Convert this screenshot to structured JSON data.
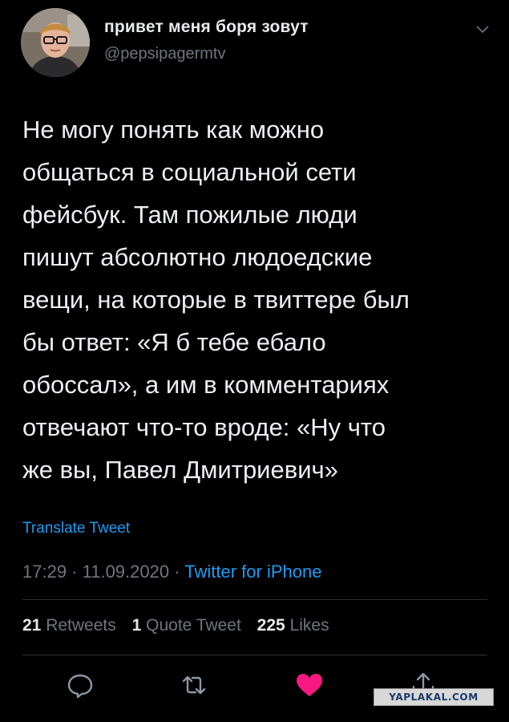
{
  "user": {
    "display_name": "привет меня боря зовут",
    "handle": "@pepsipagermtv"
  },
  "tweet": {
    "text": "Не могу понять как можно\nобщаться в социальной сети\nфейсбук. Там пожилые люди\nпишут абсолютно людоедские\nвещи, на которые в твиттере был\nбы ответ: «Я б тебе ебало\nобоссал», а им в комментариях\nотвечают что-то вроде: «Ну что\nже вы, Павел Дмитриевич»",
    "translate_label": "Translate Tweet",
    "time": "17:29",
    "date": "11.09.2020",
    "separator": " · ",
    "source": "Twitter for iPhone"
  },
  "stats": {
    "retweets_count": "21",
    "retweets_label": "Retweets",
    "quotes_count": "1",
    "quotes_label": "Quote Tweet",
    "likes_count": "225",
    "likes_label": "Likes"
  },
  "actions": {
    "like_color": "#f91880",
    "icon_color": "#8b98a5"
  },
  "icons": [
    "chevron-down-icon",
    "reply-icon",
    "retweet-icon",
    "heart-icon",
    "share-icon"
  ],
  "watermark": "YAPLAKAL.COM"
}
